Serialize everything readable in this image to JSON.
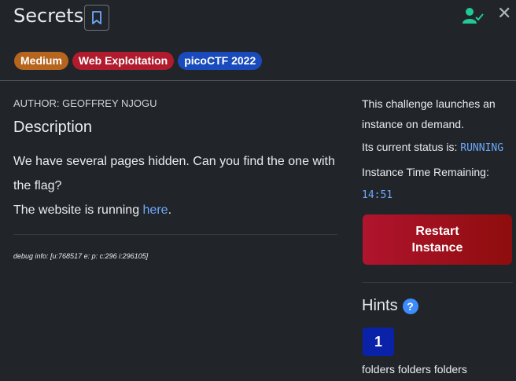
{
  "header": {
    "title": "Secrets",
    "badges": [
      {
        "label": "Medium",
        "color": "#b5651d"
      },
      {
        "label": "Web Exploitation",
        "color": "#b01b2e"
      },
      {
        "label": "picoCTF 2022",
        "color": "#1a4bbd"
      }
    ],
    "icons": {
      "bookmark": "bookmark-icon",
      "user": "user-check-icon",
      "close": "close-icon"
    }
  },
  "main": {
    "author": "AUTHOR: GEOFFREY NJOGU",
    "description_heading": "Description",
    "description_line1": "We have several pages hidden. Can you find the one with the flag?",
    "description_prefix": "The website is running ",
    "description_link": "here",
    "description_suffix": ".",
    "debug": "debug info: [u:768517 e: p: c:296 i:296105]"
  },
  "sidebar": {
    "launch_text_1": "This challenge launches an",
    "launch_text_2": "instance on demand.",
    "status_label": "Its current status is: ",
    "status_value": "RUNNING",
    "time_label": "Instance Time Remaining:",
    "time_value": "14:51",
    "restart_line1": "Restart",
    "restart_line2": "Instance",
    "hints_title": "Hints",
    "hint_number": "1",
    "hint_text": "folders folders folders"
  }
}
